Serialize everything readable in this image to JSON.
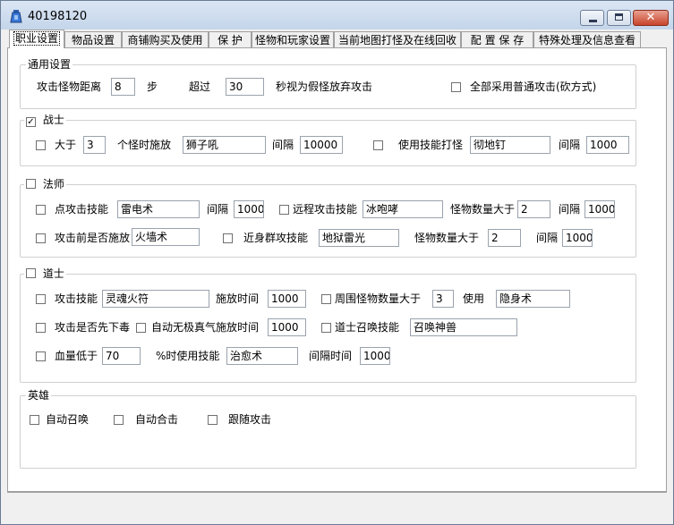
{
  "window": {
    "title": "40198120",
    "close_glyph": "✕"
  },
  "tabs": [
    "职业设置",
    "物品设置",
    "商铺购买及使用",
    "保  护",
    "怪物和玩家设置",
    "当前地图打怪及在线回收",
    "配 置 保 存",
    "特殊处理及信息查看"
  ],
  "general": {
    "title": "通用设置",
    "distance_label": "攻击怪物距离",
    "distance_value": "8",
    "steps_label": "步",
    "exceed_label": "超过",
    "exceed_value": "30",
    "fake_label": "秒视为假怪放弃攻击",
    "normal_attack_label": "全部采用普通攻击(砍方式)"
  },
  "warrior": {
    "title": "战士",
    "check_mark": "✓",
    "greater_label": "大于",
    "greater_value": "3",
    "cast_label": "个怪时施放",
    "cast_skill": "狮子吼",
    "interval_label": "间隔",
    "interval_value": "10000",
    "use_skill_label": "使用技能打怪",
    "use_skill": "彻地钉",
    "interval2_label": "间隔",
    "interval2_value": "1000"
  },
  "mage": {
    "title": "法师",
    "point_label": "点攻击技能",
    "point_skill": "雷电术",
    "interval1_label": "间隔",
    "interval1_value": "1000",
    "ranged_label": "远程攻击技能",
    "ranged_skill": "冰咆哮",
    "count1_label": "怪物数量大于",
    "count1_value": "2",
    "interval2_label": "间隔",
    "interval2_value": "1000",
    "precast_label": "攻击前是否施放",
    "precast_skill": "火墙术",
    "melee_label": "近身群攻技能",
    "melee_skill": "地狱雷光",
    "count2_label": "怪物数量大于",
    "count2_value": "2",
    "interval3_label": "间隔",
    "interval3_value": "1000"
  },
  "taoist": {
    "title": "道士",
    "attack_label": "攻击技能",
    "attack_skill": "灵魂火符",
    "cast_time_label": "施放时间",
    "cast_time_value": "1000",
    "around_label": "周围怪物数量大于",
    "around_value": "3",
    "use_label": "使用",
    "use_skill": "隐身术",
    "poison_label": "攻击是否先下毒",
    "shield_label": "自动无极真气施放时间",
    "shield_value": "1000",
    "summon_label": "道士召唤技能",
    "summon_skill": "召唤神兽",
    "hp_label": "血量低于",
    "hp_value": "70",
    "heal_label": "%时使用技能",
    "heal_skill": "治愈术",
    "heal_interval_label": "间隔时间",
    "heal_interval_value": "1000"
  },
  "hero": {
    "title": "英雄",
    "auto_summon_label": "自动召唤",
    "auto_combine_label": "自动合击",
    "follow_label": "跟随攻击"
  }
}
